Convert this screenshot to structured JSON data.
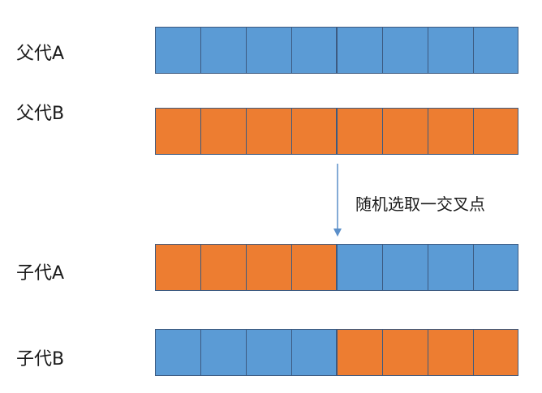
{
  "colors": {
    "parent_a": "#5b9bd5",
    "parent_b": "#ed7d31"
  },
  "rows": [
    {
      "label": "父代A",
      "left": "parent_a",
      "right": "parent_a",
      "genes_per_half": 4
    },
    {
      "label": "父代B",
      "left": "parent_b",
      "right": "parent_b",
      "genes_per_half": 4
    },
    {
      "label": "子代A",
      "left": "parent_b",
      "right": "parent_a",
      "genes_per_half": 4
    },
    {
      "label": "子代B",
      "left": "parent_a",
      "right": "parent_b",
      "genes_per_half": 4
    }
  ],
  "arrow_label": "随机选取一交叉点"
}
